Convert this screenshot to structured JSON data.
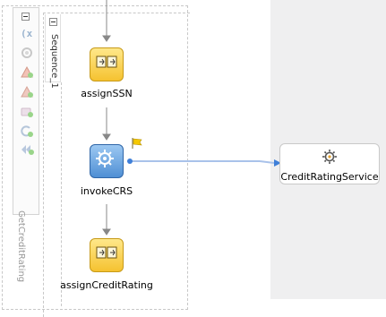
{
  "toolbar": {
    "items": [
      {
        "icon": "collapse-icon"
      },
      {
        "icon": "variables-icon"
      },
      {
        "icon": "correlation-sets-icon"
      },
      {
        "icon": "add-fault-handler-icon"
      },
      {
        "icon": "add-catch-icon"
      },
      {
        "icon": "add-event-handler-icon"
      },
      {
        "icon": "add-compensation-icon"
      },
      {
        "icon": "add-termination-icon"
      }
    ],
    "scope_label": "GetCreditRating"
  },
  "sequence": {
    "label": "Sequence_1"
  },
  "activities": {
    "assign_ssn": {
      "label": "assignSSN"
    },
    "invoke_crs": {
      "label": "invokeCRS"
    },
    "assign_credit_rating": {
      "label": "assignCreditRating"
    }
  },
  "partner_link": {
    "label": "CreditRatingService"
  },
  "colors": {
    "connector": "#888888",
    "partner_wire": "#5b8ed6",
    "lane": "#efeff0"
  }
}
